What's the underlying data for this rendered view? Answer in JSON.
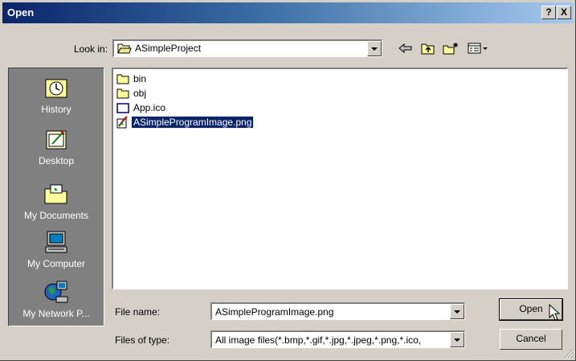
{
  "window": {
    "title": "Open"
  },
  "titlebar": {
    "help_label": "?",
    "close_label": "X"
  },
  "toolbar": {
    "look_in_label": "Look in:",
    "look_in_value": "ASimpleProject",
    "icons": [
      "back-arrow-icon",
      "up-folder-icon",
      "new-folder-icon",
      "view-menu-icon"
    ]
  },
  "places": [
    {
      "label": "History",
      "icon": "history-icon"
    },
    {
      "label": "Desktop",
      "icon": "desktop-icon"
    },
    {
      "label": "My Documents",
      "icon": "my-documents-icon"
    },
    {
      "label": "My Computer",
      "icon": "my-computer-icon"
    },
    {
      "label": "My Network P...",
      "icon": "my-network-places-icon"
    }
  ],
  "files": [
    {
      "name": "bin",
      "type": "folder"
    },
    {
      "name": "obj",
      "type": "folder"
    },
    {
      "name": "App.ico",
      "type": "ico"
    },
    {
      "name": "ASimpleProgramImage.png",
      "type": "png",
      "selected": true
    }
  ],
  "filename": {
    "label": "File name:",
    "value": "ASimpleProgramImage.png"
  },
  "filetype": {
    "label": "Files of type:",
    "value": "All image files(*.bmp,*.gif,*.jpg,*.jpeg,*.png,*.ico,"
  },
  "buttons": {
    "open": "Open",
    "cancel": "Cancel"
  },
  "colors": {
    "titlebar_start": "#0a246a",
    "titlebar_end": "#a6caf0",
    "selection": "#0a246a",
    "face": "#d4d0c8"
  }
}
